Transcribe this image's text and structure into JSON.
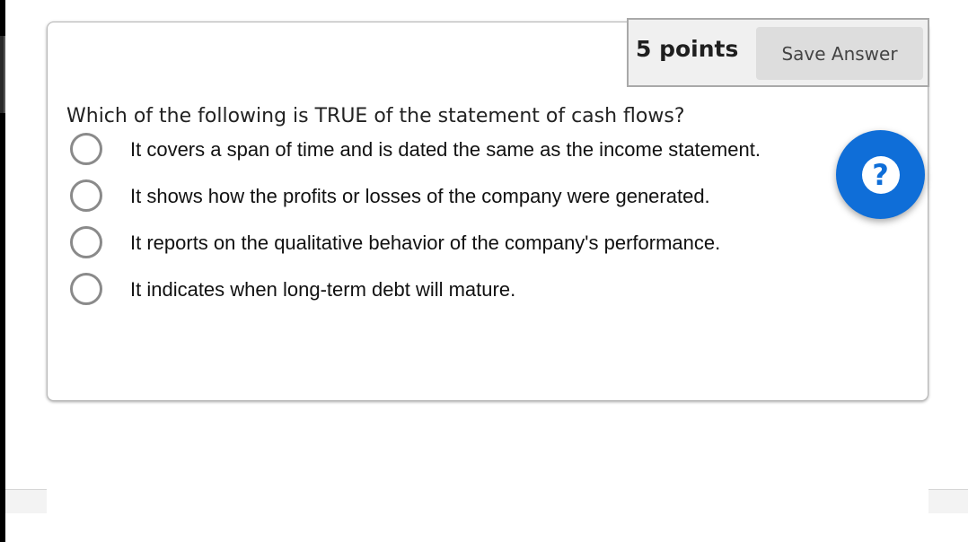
{
  "assessment": {
    "points_label": "5 points",
    "save_label": "Save Answer",
    "question": "Which of the following is TRUE of the statement of cash flows?",
    "options": [
      {
        "label": "It covers a span of time and is dated the same as the income statement."
      },
      {
        "label": "It shows how the profits or losses of the company were generated."
      },
      {
        "label": "It reports on the qualitative behavior of the company's performance."
      },
      {
        "label": "It indicates when long-term debt will mature."
      }
    ]
  },
  "help": {
    "icon": "question-mark-icon",
    "glyph": "?",
    "color": "#0f6ed8"
  }
}
